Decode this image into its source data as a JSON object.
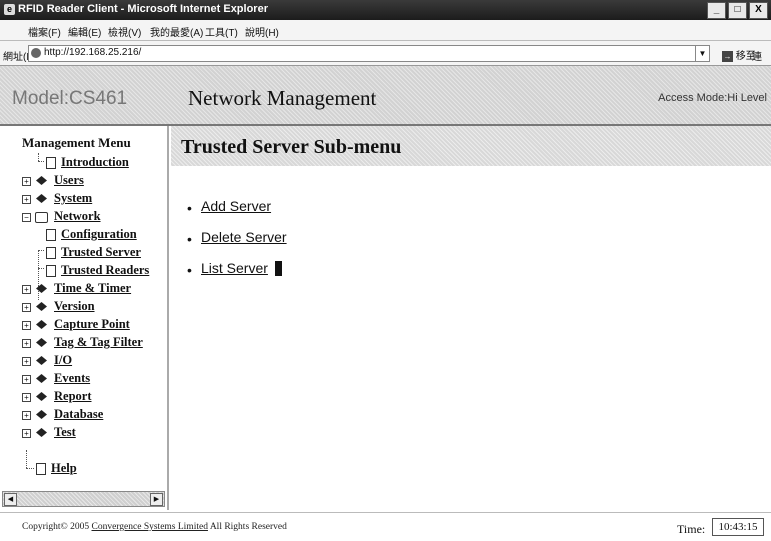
{
  "window": {
    "title": "RFID Reader Client - Microsoft Internet Explorer",
    "buttons": [
      "_",
      "□",
      "X"
    ]
  },
  "browser_menu": [
    "檔案(F)",
    "編輯(E)",
    "檢視(V)",
    "我的最愛(A)",
    "工具(T)",
    "說明(H)"
  ],
  "address": {
    "label": "網址(D)",
    "url": "http://192.168.25.216/",
    "go_label": "移至",
    "links_label": "連結"
  },
  "header": {
    "model": "Model:CS461",
    "title": "Network Management",
    "access": "Access Mode:Hi Level"
  },
  "menu": {
    "title": "Management Menu",
    "items": [
      {
        "label": "Introduction"
      },
      {
        "label": "Users"
      },
      {
        "label": "System"
      },
      {
        "label": "Network"
      },
      {
        "label": "Configuration"
      },
      {
        "label": "Trusted Server"
      },
      {
        "label": "Trusted Readers"
      },
      {
        "label": "Time & Timer"
      },
      {
        "label": "Version"
      },
      {
        "label": "Capture Point"
      },
      {
        "label": "Tag & Tag Filter"
      },
      {
        "label": "I/O"
      },
      {
        "label": "Events"
      },
      {
        "label": "Report"
      },
      {
        "label": "Database"
      },
      {
        "label": "Test"
      },
      {
        "label": "Help"
      }
    ]
  },
  "content": {
    "subtitle": "Trusted Server Sub-menu",
    "links": [
      {
        "label": "Add Server"
      },
      {
        "label": "Delete Server"
      },
      {
        "label": "List Server"
      }
    ]
  },
  "footer": {
    "copyright_prefix": "Copyright© 2005",
    "company": "Convergence Systems Limited",
    "rights": "All Rights Reserved",
    "time_label": "Time:",
    "time_value": "10:43:15"
  },
  "icons": {
    "expand": "plus-box-icon",
    "book": "book-icon",
    "page": "page-icon",
    "folder": "open-folder-icon"
  }
}
